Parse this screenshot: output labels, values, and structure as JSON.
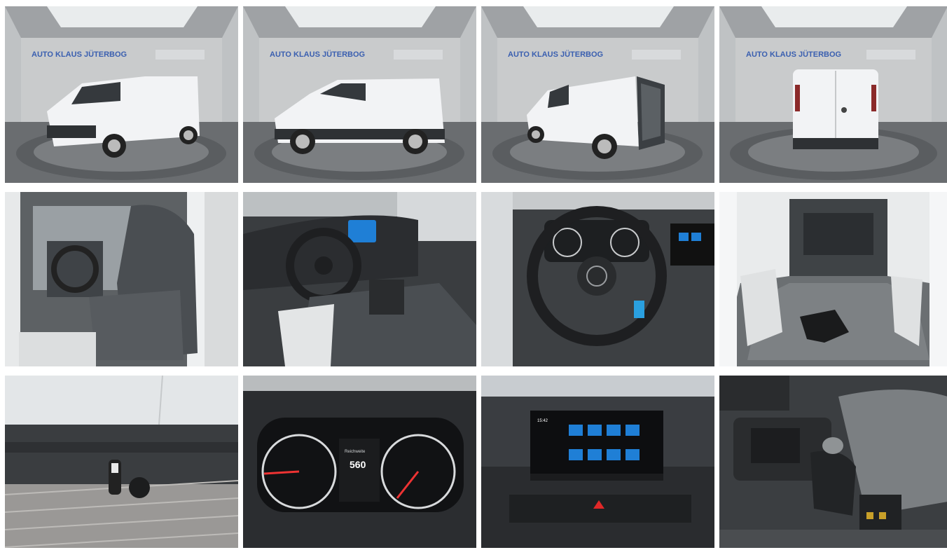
{
  "gallery": {
    "showroom_sign": "AUTO KLAUS JÜTERBOG",
    "photos": [
      {
        "view": "exterior-front-left",
        "sign": "AUTO KLAUS JÜTERBOG"
      },
      {
        "view": "exterior-side-left",
        "sign": "AUTO KLAUS JÜTERBOG"
      },
      {
        "view": "exterior-rear-left-open-door",
        "sign": "AUTO KLAUS JÜTERBOG"
      },
      {
        "view": "exterior-rear",
        "sign": "AUTO KLAUS JÜTERBOG"
      },
      {
        "view": "interior-front-seats"
      },
      {
        "view": "interior-dashboard"
      },
      {
        "view": "interior-steering-wheel"
      },
      {
        "view": "cargo-area"
      },
      {
        "view": "tow-hitch"
      },
      {
        "view": "instrument-cluster",
        "display_text": "Reichweite",
        "range_value": "560"
      },
      {
        "view": "infotainment-screen",
        "clock": "15:42"
      },
      {
        "view": "gear-shifter"
      }
    ]
  },
  "colors": {
    "van_white": "#f2f3f5",
    "showroom_wall": "#c9cbcc",
    "floor": "#5a5d60",
    "dash": "#2b2d30",
    "screen_blue": "#1f7fd6"
  }
}
